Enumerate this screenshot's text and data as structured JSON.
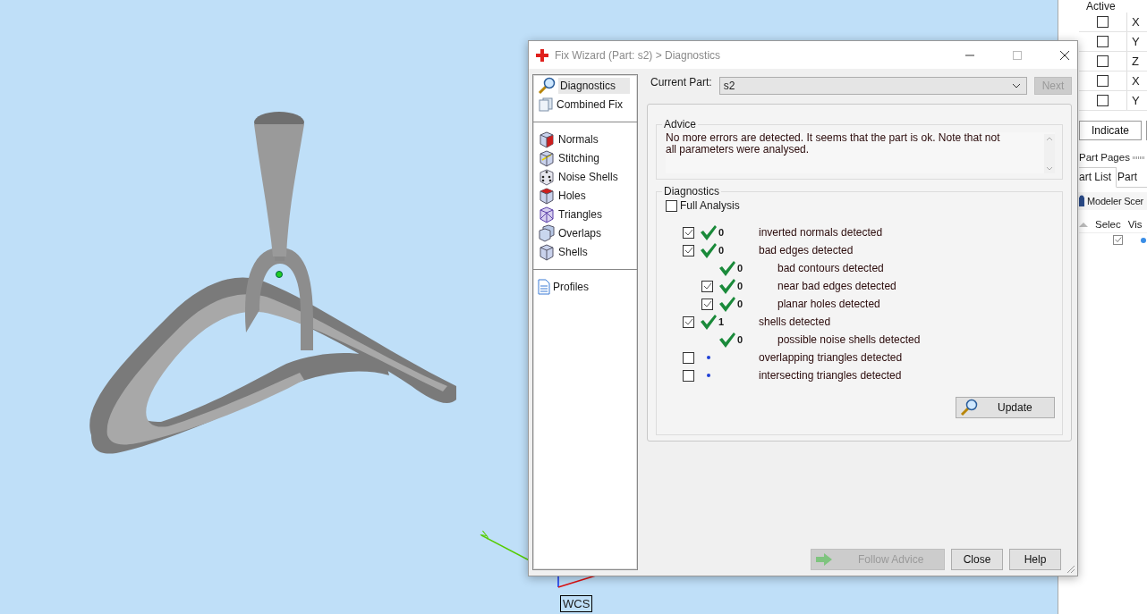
{
  "viewport": {
    "axis_label": "y",
    "wcs_label": "WCS"
  },
  "dialog": {
    "title": "Fix Wizard (Part: s2) > Diagnostics"
  },
  "nav": [
    {
      "items": [
        {
          "label": "Diagnostics",
          "kind": "magnifier",
          "selected": true
        },
        {
          "label": "Combined Fix",
          "kind": "pages",
          "selected": false
        }
      ]
    },
    {
      "items": [
        {
          "label": "Normals",
          "kind": "cube-red",
          "selected": false
        },
        {
          "label": "Stitching",
          "kind": "cube-edge",
          "selected": false
        },
        {
          "label": "Noise Shells",
          "kind": "dice",
          "selected": false
        },
        {
          "label": "Holes",
          "kind": "cube-top",
          "selected": false
        },
        {
          "label": "Triangles",
          "kind": "wire",
          "selected": false
        },
        {
          "label": "Overlaps",
          "kind": "cube-double",
          "selected": false
        },
        {
          "label": "Shells",
          "kind": "cube",
          "selected": false
        }
      ]
    },
    {
      "items": [
        {
          "label": "Profiles",
          "kind": "document",
          "selected": false
        }
      ]
    }
  ],
  "current_part": {
    "label": "Current Part:",
    "value": "s2"
  },
  "next_button": {
    "label": "Next",
    "disabled": true
  },
  "advice": {
    "title": "Advice",
    "text": "No more errors are detected. It seems that the part is ok. Note that not all parameters were analysed."
  },
  "diagnostics": {
    "title": "Diagnostics",
    "full_analysis": {
      "label": "Full Analysis",
      "checked": false
    },
    "rows": [
      {
        "kind": "check",
        "checked": true,
        "passed": true,
        "count": "0",
        "label": "inverted normals detected"
      },
      {
        "kind": "check",
        "checked": true,
        "passed": true,
        "count": "0",
        "label": "bad edges detected",
        "children": [
          {
            "kind": "plain",
            "passed": true,
            "count": "0",
            "label": "bad contours detected"
          },
          {
            "kind": "check",
            "checked": true,
            "passed": true,
            "count": "0",
            "label": "near bad edges detected"
          },
          {
            "kind": "check",
            "checked": true,
            "passed": true,
            "count": "0",
            "label": "planar holes detected"
          }
        ]
      },
      {
        "kind": "check",
        "checked": true,
        "passed": true,
        "count": "1",
        "label": "shells detected",
        "children": [
          {
            "kind": "plain",
            "passed": true,
            "count": "0",
            "label": "possible noise shells detected"
          }
        ]
      },
      {
        "kind": "check",
        "checked": false,
        "passed": false,
        "label": "overlapping triangles detected"
      },
      {
        "kind": "check",
        "checked": false,
        "passed": false,
        "label": "intersecting triangles detected"
      }
    ],
    "update_button": "Update"
  },
  "buttons": [
    {
      "label": "Follow Advice",
      "kind": "arrow",
      "disabled": true
    },
    {
      "label": "Close",
      "disabled": false
    },
    {
      "label": "Help",
      "disabled": false
    }
  ],
  "side_panel": {
    "columns": [
      "Active"
    ],
    "rows": [
      {
        "active": false,
        "column_2": "X"
      },
      {
        "active": false,
        "column_2": "Y"
      },
      {
        "active": false,
        "column_2": "Z"
      },
      {
        "active": false,
        "column_2": "X"
      },
      {
        "active": false,
        "column_2": "Y"
      }
    ],
    "indicate_button": "Indicate",
    "part_pages": "Part Pages",
    "tabs": [
      {
        "label": "art List",
        "selected": true
      },
      {
        "label": "Part",
        "selected": false
      }
    ],
    "scene_label": "Modeler Scer",
    "list_columns": [
      "Selec",
      "Vis"
    ],
    "list_rows": [
      {
        "selected": true
      }
    ]
  }
}
